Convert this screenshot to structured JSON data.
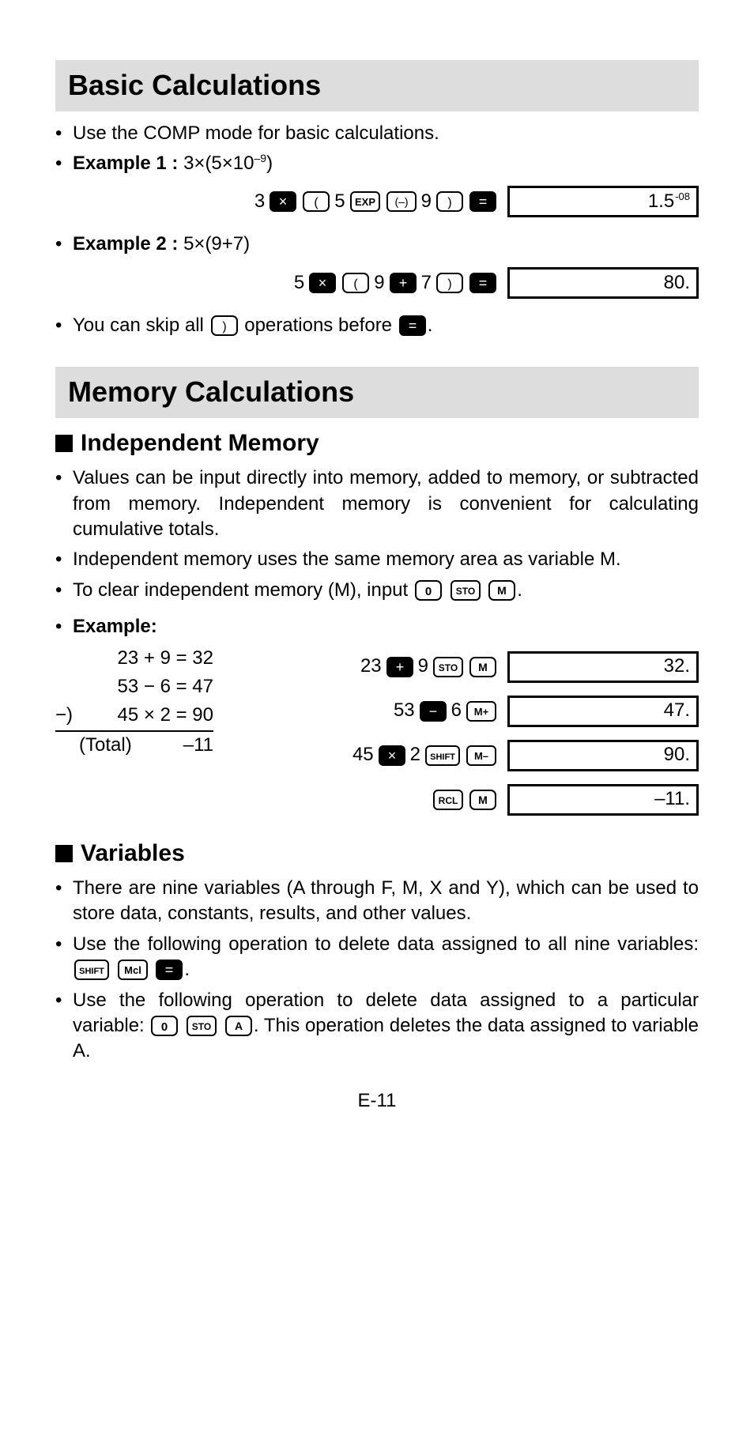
{
  "section1": {
    "title": "Basic Calculations",
    "bullet1": "Use the COMP mode for basic calculations.",
    "ex1_label": "Example 1 :",
    "ex1_expr_pre": " 3×(5×10",
    "ex1_expr_sup": "–9",
    "ex1_expr_post": ")",
    "ex1_result": "1.5",
    "ex1_result_sup": "-08",
    "ex2_label": "Example 2 :",
    "ex2_expr": " 5×(9+7)",
    "ex2_result": "80.",
    "note_pre": "You can skip all ",
    "note_mid": " operations before ",
    "note_post": "."
  },
  "section2": {
    "title": "Memory Calculations",
    "sub1": "Independent Memory",
    "p1": "Values can be input directly into memory, added to memory, or subtracted from memory. Independent memory is convenient for calculating cumulative totals.",
    "p2": "Independent memory uses the same memory area as variable M.",
    "p3_pre": "To clear independent memory (M), input ",
    "p3_post": ".",
    "ex_label": "Example:",
    "left": {
      "r1": "23 + 9 = 32",
      "r2": "53 − 6 = 47",
      "r3_minus": "−) ",
      "r3": "45 × 2 = 90",
      "r4_label": "(Total)",
      "r4_val": "–11"
    },
    "results": {
      "r1": "32.",
      "r2": "47.",
      "r3": "90.",
      "r4": "–11."
    },
    "sub2": "Variables",
    "v1": "There are nine variables (A through F, M, X and Y), which can be used to store data, constants, results, and other values.",
    "v2_pre": "Use the following operation to delete data assigned to all nine variables: ",
    "v2_post": ".",
    "v3_pre": "Use the following operation to delete data assigned to a particular variable: ",
    "v3_post": ". This operation deletes the data assigned to variable A."
  },
  "footer": "E-11",
  "digits": {
    "d3": "3",
    "d5": "5",
    "d9": "9",
    "d7": "7",
    "d2": "2",
    "d6": "6",
    "n23": "23",
    "n53": "53",
    "n45": "45"
  }
}
